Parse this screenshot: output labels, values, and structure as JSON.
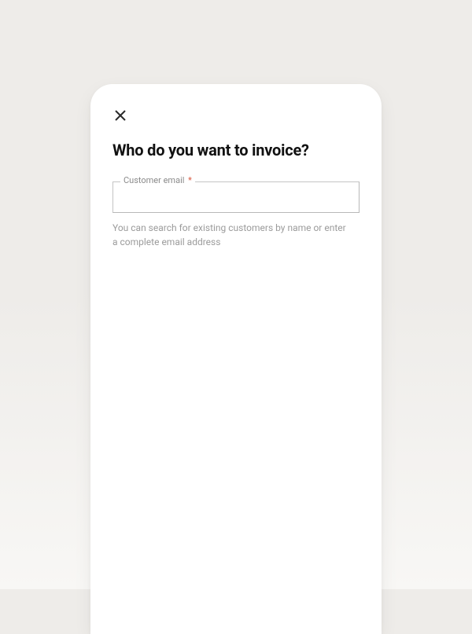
{
  "modal": {
    "title": "Who do you want to invoice?",
    "field": {
      "label": "Customer email",
      "required_marker": "*",
      "value": "",
      "helper": "You can search for existing customers by name or enter a complete email address"
    }
  }
}
